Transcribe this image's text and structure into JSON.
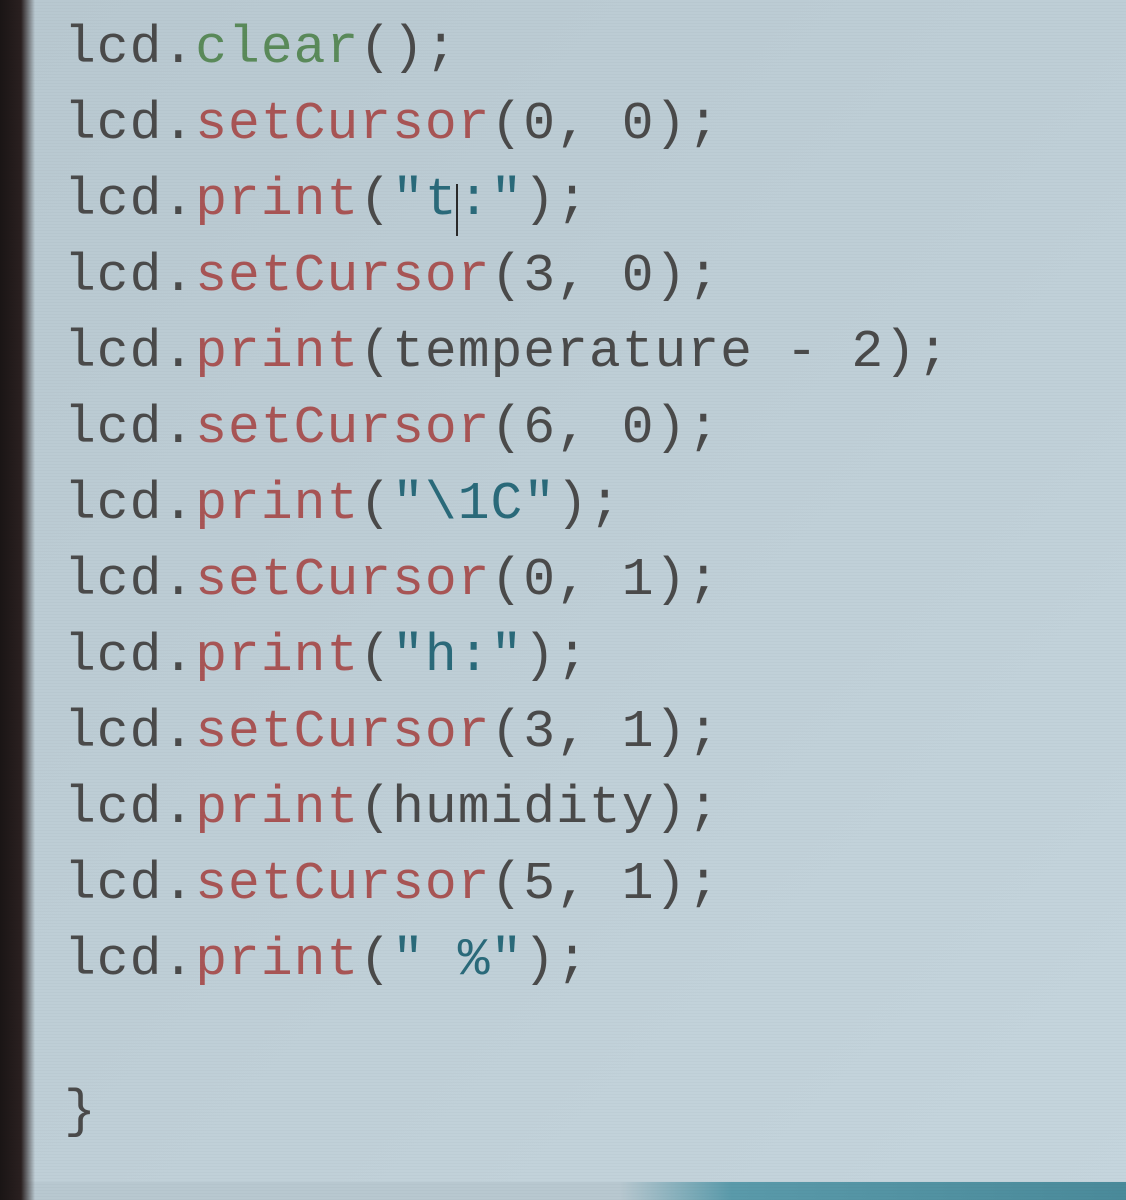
{
  "code": {
    "lines": [
      {
        "object": "lcd",
        "method": "clear",
        "methodStyle": "green",
        "args": [],
        "hasCursor": false
      },
      {
        "object": "lcd",
        "method": "setCursor",
        "methodStyle": "red",
        "args": [
          {
            "type": "num",
            "value": "0"
          },
          {
            "type": "num",
            "value": "0"
          }
        ],
        "hasCursor": false
      },
      {
        "object": "lcd",
        "method": "print",
        "methodStyle": "red",
        "args": [
          {
            "type": "string",
            "value": "\"t:\""
          }
        ],
        "hasCursor": true,
        "cursorAfter": "t"
      },
      {
        "object": "lcd",
        "method": "setCursor",
        "methodStyle": "red",
        "args": [
          {
            "type": "num",
            "value": "3"
          },
          {
            "type": "num",
            "value": "0"
          }
        ],
        "hasCursor": false
      },
      {
        "object": "lcd",
        "method": "print",
        "methodStyle": "red",
        "args": [
          {
            "type": "expr",
            "parts": [
              {
                "t": "var",
                "v": "temperature"
              },
              {
                "t": "op",
                "v": " - "
              },
              {
                "t": "num",
                "v": "2"
              }
            ]
          }
        ],
        "hasCursor": false
      },
      {
        "object": "lcd",
        "method": "setCursor",
        "methodStyle": "red",
        "args": [
          {
            "type": "num",
            "value": "6"
          },
          {
            "type": "num",
            "value": "0"
          }
        ],
        "hasCursor": false
      },
      {
        "object": "lcd",
        "method": "print",
        "methodStyle": "red",
        "args": [
          {
            "type": "string",
            "value": "\"\\1C\""
          }
        ],
        "hasCursor": false
      },
      {
        "object": "lcd",
        "method": "setCursor",
        "methodStyle": "red",
        "args": [
          {
            "type": "num",
            "value": "0"
          },
          {
            "type": "num",
            "value": "1"
          }
        ],
        "hasCursor": false
      },
      {
        "object": "lcd",
        "method": "print",
        "methodStyle": "red",
        "args": [
          {
            "type": "string",
            "value": "\"h:\""
          }
        ],
        "hasCursor": false
      },
      {
        "object": "lcd",
        "method": "setCursor",
        "methodStyle": "red",
        "args": [
          {
            "type": "num",
            "value": "3"
          },
          {
            "type": "num",
            "value": "1"
          }
        ],
        "hasCursor": false
      },
      {
        "object": "lcd",
        "method": "print",
        "methodStyle": "red",
        "args": [
          {
            "type": "var",
            "value": "humidity"
          }
        ],
        "hasCursor": false
      },
      {
        "object": "lcd",
        "method": "setCursor",
        "methodStyle": "red",
        "args": [
          {
            "type": "num",
            "value": "5"
          },
          {
            "type": "num",
            "value": "1"
          }
        ],
        "hasCursor": false
      },
      {
        "object": "lcd",
        "method": "print",
        "methodStyle": "red",
        "args": [
          {
            "type": "string",
            "value": "\" %\""
          }
        ],
        "hasCursor": false
      }
    ],
    "closingBrace": "}"
  }
}
